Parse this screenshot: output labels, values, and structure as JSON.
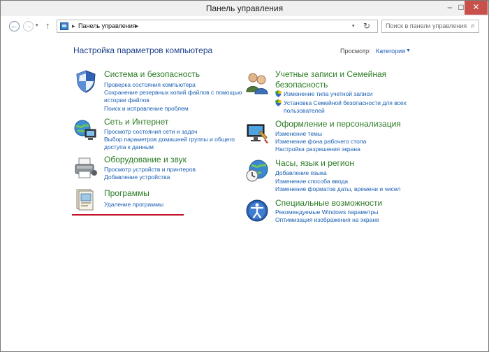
{
  "window": {
    "title": "Панель управления",
    "min_glyph": "–",
    "max_glyph": "□",
    "close_glyph": "✕"
  },
  "nav": {
    "back_glyph": "←",
    "forward_glyph": "→",
    "dropdown_glyph": "▾",
    "up_glyph": "↑",
    "address_sep": "▸",
    "address_text": "Панель управления",
    "refresh_glyph": "↻",
    "search_placeholder": "Поиск в панели управления",
    "search_glyph": "⌕"
  },
  "main": {
    "heading": "Настройка параметров компьютера",
    "view_label": "Просмотр:",
    "view_value": "Категория",
    "view_arrow": "▼"
  },
  "categories_left": [
    {
      "icon": "shield-security-icon",
      "title": "Система и безопасность",
      "links": [
        "Проверка состояния компьютера",
        "Сохранение резервных копий файлов с помощью",
        "истории файлов",
        "Поиск и исправление проблем"
      ]
    },
    {
      "icon": "network-globe-icon",
      "title": "Сеть и Интернет",
      "links": [
        "Просмотр состояния сети и задач",
        "Выбор параметров домашней группы и общего",
        "доступа к данным"
      ]
    },
    {
      "icon": "printer-icon",
      "title": "Оборудование и звук",
      "links": [
        "Просмотр устройств и принтеров",
        "Добавление устройства"
      ]
    },
    {
      "icon": "programs-icon",
      "title": "Программы",
      "links": [
        "Удаление программы"
      ]
    }
  ],
  "categories_right": [
    {
      "icon": "users-icon",
      "title_line1": "Учетные записи и Семейная",
      "title_line2": "безопасность",
      "links": [
        "Изменение типа учетной записи",
        "Установка Семейной безопасности для всех",
        "пользователей"
      ]
    },
    {
      "icon": "appearance-icon",
      "title": "Оформление и персонализация",
      "links": [
        "Изменение темы",
        "Изменение фона рабочего стола",
        "Настройка разрешения экрана"
      ]
    },
    {
      "icon": "clock-globe-icon",
      "title": "Часы, язык и регион",
      "links": [
        "Добавление языка",
        "Изменение способа ввода",
        "Изменение форматов даты, времени и чисел"
      ]
    },
    {
      "icon": "accessibility-icon",
      "title": "Специальные возможности",
      "links": [
        "Рекомендуемые Windows параметры",
        "Оптимизация изображения на экране"
      ]
    }
  ]
}
